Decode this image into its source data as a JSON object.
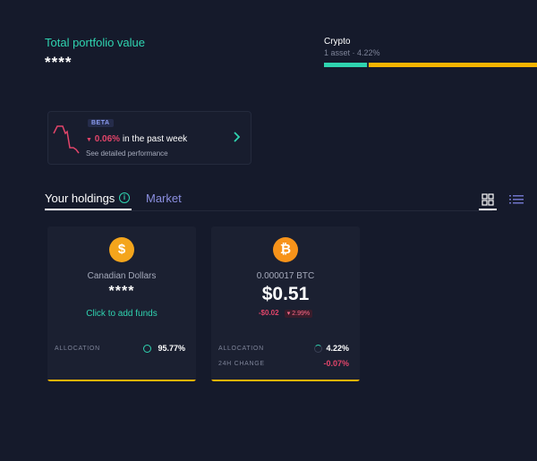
{
  "portfolio": {
    "title": "Total portfolio value",
    "value_masked": "****"
  },
  "allocation_summary": {
    "label": "Crypto",
    "subtitle": "1 asset · 4.22%",
    "segments": [
      {
        "name": "Canadian Dollars",
        "percent": 95.77,
        "color": "#2fd4b0"
      },
      {
        "name": "Crypto",
        "percent": 4.22,
        "color": "#f4b400"
      }
    ]
  },
  "performance": {
    "badge": "BETA",
    "arrow": "▼",
    "change": "0.06%",
    "period_text": "in the past week",
    "link": "See detailed performance",
    "line_color": "#e2456a"
  },
  "tabs": {
    "holdings": "Your holdings",
    "market": "Market",
    "info_icon": "i"
  },
  "holdings": [
    {
      "icon_glyph": "$",
      "icon_color": "#f4a51c",
      "name": "Canadian Dollars",
      "value": "****",
      "action": "Click to add funds",
      "allocation_label": "ALLOCATION",
      "allocation": "95.77%",
      "allocation_icon_color": "#2fd4b0"
    },
    {
      "icon_glyph": "₿",
      "icon_color": "#f7931a",
      "name": "0.000017 BTC",
      "value": "$0.51",
      "change": "-$0.02",
      "change_pct": "▾ 2.99%",
      "allocation_label": "ALLOCATION",
      "allocation": "4.22%",
      "change_24h_label": "24H CHANGE",
      "change_24h": "-0.07%",
      "allocation_icon_color": "#2fd4b0"
    }
  ],
  "accent_color": "#f4b400"
}
